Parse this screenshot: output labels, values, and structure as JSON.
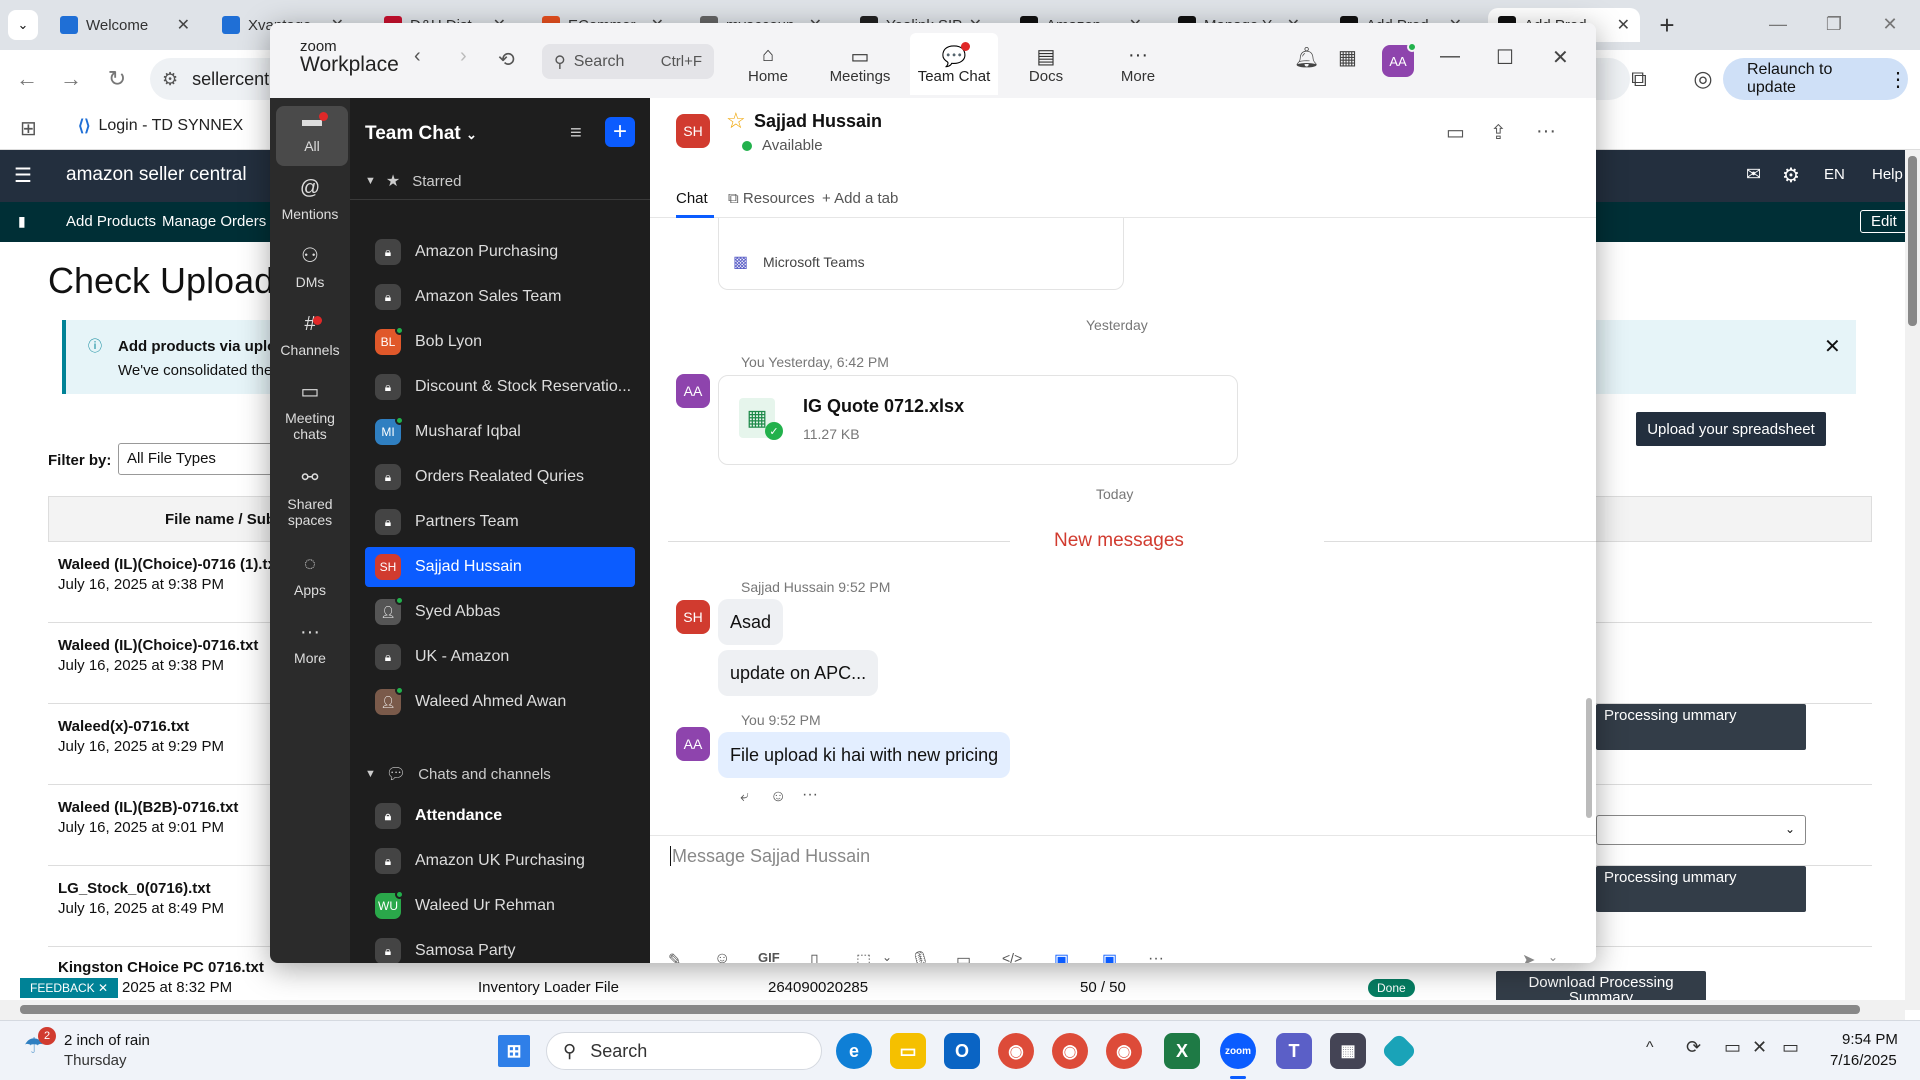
{
  "browser": {
    "tabs": [
      {
        "label": "Welcome",
        "color": "#1f6fd6"
      },
      {
        "label": "Xvantage",
        "color": "#1f6fd6"
      },
      {
        "label": "D&H Dist",
        "color": "#c8102e"
      },
      {
        "label": "ECommer",
        "color": "#e8501f"
      },
      {
        "label": "myaccoun",
        "color": "#666666"
      },
      {
        "label": "Yealink SIP",
        "color": "#222222"
      },
      {
        "label": "Amazon",
        "color": "#111111"
      },
      {
        "label": "Manage Y",
        "color": "#111111"
      },
      {
        "label": "Add Prod",
        "color": "#111111"
      },
      {
        "label": "Add Prod",
        "color": "#111111"
      }
    ],
    "address": "sellercent",
    "relaunch": "Relaunch to update",
    "bookmarks": [
      "Login - TD SYNNEX"
    ]
  },
  "seller": {
    "brand": "amazon seller central",
    "header_right": [
      "EN",
      "Help"
    ],
    "subnav": [
      "Add Products",
      "Manage Orders"
    ],
    "edit": "Edit",
    "title": "Check Upload",
    "banner_title": "Add products via uplo",
    "banner_text": "We've consolidated the t",
    "filter_label": "Filter by:",
    "filter_value": "All File Types",
    "col_header": "File name / Subr",
    "upload_btn": "Upload your spreadsheet",
    "rows": [
      {
        "file": "Waleed (IL)(Choice)-0716 (1).txt",
        "date": "July 16, 2025 at 9:38 PM"
      },
      {
        "file": "Waleed (IL)(Choice)-0716.txt",
        "date": "July 16, 2025 at 9:38 PM"
      },
      {
        "file": "Waleed(x)-0716.txt",
        "date": "July 16, 2025 at 9:29 PM"
      },
      {
        "file": "Waleed (IL)(B2B)-0716.txt",
        "date": "July 16, 2025 at 9:01 PM"
      },
      {
        "file": "LG_Stock_0(0716).txt",
        "date": "July 16, 2025 at 8:49 PM"
      },
      {
        "file": "Kingston CHoice PC 0716.txt",
        "date": "2025 at 8:32 PM"
      }
    ],
    "last_row": {
      "type": "Inventory Loader File",
      "id": "264090020285",
      "count": "50 / 50",
      "status": "Done",
      "btn": "Download Processing Summary"
    },
    "proc_btn": "Processing ummary",
    "feedback": "FEEDBACK"
  },
  "zoom": {
    "brand_top": "zoom",
    "brand_bottom": "Workplace",
    "search": "Search",
    "search_shortcut": "Ctrl+F",
    "tabs": [
      {
        "label": "Home",
        "icon": "home-icon"
      },
      {
        "label": "Meetings",
        "icon": "video-icon"
      },
      {
        "label": "Team Chat",
        "icon": "chat-icon"
      },
      {
        "label": "Docs",
        "icon": "doc-icon"
      },
      {
        "label": "More",
        "icon": "more-icon"
      }
    ],
    "avatar": "AA",
    "rail": [
      "All",
      "Mentions",
      "DMs",
      "Channels",
      "Meeting chats",
      "Shared spaces",
      "Apps",
      "More"
    ],
    "list_title": "Team Chat",
    "starred_label": "Starred",
    "starred": [
      {
        "name": "Amazon Purchasing",
        "av": "",
        "color": "#444444",
        "lock": true
      },
      {
        "name": "Amazon Sales Team",
        "av": "",
        "color": "#444444",
        "lock": true
      },
      {
        "name": "Bob Lyon",
        "av": "BL",
        "color": "#e0582a",
        "online": true
      },
      {
        "name": "Discount & Stock Reservatio...",
        "av": "",
        "color": "#444444",
        "lock": true
      },
      {
        "name": "Musharaf Iqbal",
        "av": "MI",
        "color": "#2f7fc1",
        "online": true
      },
      {
        "name": "Orders Realated Quries",
        "av": "",
        "color": "#444444",
        "lock": true
      },
      {
        "name": "Partners Team",
        "av": "",
        "color": "#444444",
        "lock": true
      },
      {
        "name": "Sajjad Hussain",
        "av": "SH",
        "color": "#d13b2f",
        "selected": true
      },
      {
        "name": "Syed Abbas",
        "av": "",
        "color": "#555555",
        "online": true
      },
      {
        "name": "UK - Amazon",
        "av": "",
        "color": "#444444",
        "lock": true
      },
      {
        "name": "Waleed Ahmed Awan",
        "av": "",
        "color": "#7a5a4a",
        "online": true
      }
    ],
    "chats_label": "Chats and channels",
    "chats": [
      {
        "name": "Attendance",
        "av": "",
        "color": "#444444",
        "lock": true,
        "bold": true
      },
      {
        "name": "Amazon UK Purchasing",
        "av": "",
        "color": "#444444",
        "lock": true
      },
      {
        "name": "Waleed Ur Rehman",
        "av": "WU",
        "color": "#2aa84a",
        "online": true
      },
      {
        "name": "Samosa Party",
        "av": "",
        "color": "#444444",
        "lock": true
      }
    ],
    "chat": {
      "name": "Sajjad Hussain",
      "initials": "SH",
      "status": "Available",
      "tabs": [
        "Chat",
        "Resources",
        "Add a tab"
      ],
      "teams_card": "Microsoft Teams",
      "day1": "Yesterday",
      "file_meta": "You Yesterday, 6:42 PM",
      "file_name": "IG Quote 0712.xlsx",
      "file_size": "11.27 KB",
      "day2": "Today",
      "new_messages": "New messages",
      "m1_meta": "Sajjad Hussain 9:52 PM",
      "m1a": "Asad",
      "m1b": "update on APC...",
      "m2_meta": "You 9:52 PM",
      "m2": "File upload ki hai with new pricing",
      "me_initials": "AA",
      "placeholder": "Message Sajjad Hussain"
    }
  },
  "taskbar": {
    "weather": "2 inch of rain",
    "weather_day": "Thursday",
    "weather_badge": "2",
    "search": "Search",
    "time": "9:54 PM",
    "date": "7/16/2025"
  }
}
